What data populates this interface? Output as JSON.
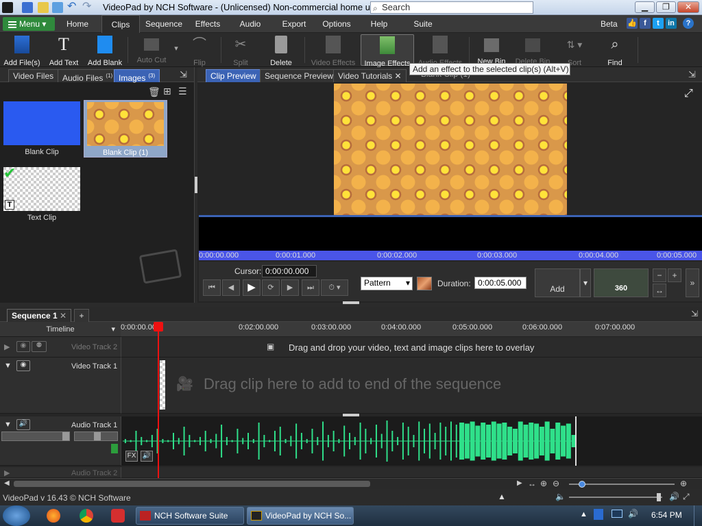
{
  "window": {
    "title": "VideoPad by NCH Software - (Unlicensed) Non-commercial home use only",
    "search_placeholder": "Search"
  },
  "menu": {
    "menu_button": "Menu",
    "items": [
      "Home",
      "Clips",
      "Sequence",
      "Effects",
      "Audio",
      "Export",
      "Options",
      "Help",
      "Suite"
    ],
    "active": "Clips",
    "beta": "Beta"
  },
  "toolbar": {
    "add_files": "Add File(s)",
    "add_text": "Add Text",
    "add_blank": "Add Blank",
    "auto_cut": "Auto Cut",
    "flip": "Flip",
    "split": "Split",
    "delete": "Delete",
    "video_effects": "Video Effects",
    "image_effects": "Image Effects",
    "audio_effects": "Audio Effects",
    "new_bin": "New Bin",
    "delete_bin": "Delete Bin",
    "sort": "Sort",
    "find": "Find"
  },
  "tooltip": "Add an effect to the selected clip(s) (Alt+V)",
  "bin": {
    "tabs": [
      "Video Files",
      "Audio Files",
      "Images"
    ],
    "tab_badges": [
      "",
      "(1)",
      "(3)"
    ],
    "clips": [
      "Blank Clip",
      "Blank Clip (1)",
      "Text Clip"
    ]
  },
  "preview": {
    "tabs": [
      "Clip Preview",
      "Sequence Preview",
      "Video Tutorials"
    ],
    "clip_tab_title": "Blank Clip (1)",
    "ruler": [
      "0:00:00.000",
      "0:00:01.000",
      "0:00:02.000",
      "0:00:03.000",
      "0:00:04.000",
      "0:00:05.000"
    ],
    "cursor_label": "Cursor:",
    "cursor_value": "0:00:00.000",
    "pattern_value": "Pattern",
    "duration_label": "Duration:",
    "duration_value": "0:00:05.000",
    "add_label": "Add",
    "vr_label": "360"
  },
  "sequence": {
    "tab": "Sequence 1",
    "timeline_label": "Timeline",
    "ruler": [
      "0:00:00.000",
      "0:02:00.000",
      "0:03:00.000",
      "0:04:00.000",
      "0:05:00.000",
      "0:06:00.000",
      "0:07:00.000"
    ],
    "video_track_2": "Video Track 2",
    "overlay_hint": "Drag and drop your video, text and image clips here to overlay",
    "video_track_1": "Video Track 1",
    "drag_hint": "Drag clip here to add to end of the sequence",
    "audio_track_1": "Audio Track 1",
    "audio_track_2": "Audio Track 2",
    "fx": "FX"
  },
  "status": {
    "version": "VideoPad v 16.43 © NCH Software"
  },
  "taskbar": {
    "apps": [
      "NCH Software Suite",
      "VideoPad by NCH So..."
    ],
    "clock": "6:54 PM"
  },
  "colors": {
    "accent": "#3b63b5",
    "menu_green": "#2f8a3c",
    "waveform": "#2fe08a",
    "playhead": "#e11111"
  },
  "waveform_levels": [
    0.1,
    0.05,
    0.5,
    0.2,
    0.05,
    0.3,
    0.6,
    0.1,
    0.05,
    0.4,
    0.15,
    0.7,
    0.3,
    0.05,
    0.2,
    0.5,
    0.1,
    0.35,
    0.8,
    0.2,
    0.05,
    0.6,
    0.15,
    0.4,
    0.1,
    0.9,
    0.3,
    0.05,
    0.5,
    0.7,
    0.1,
    0.25,
    0.85,
    0.4,
    0.1,
    0.6,
    0.2,
    0.95,
    0.3,
    0.5,
    0.1,
    0.75,
    0.4,
    0.2,
    0.9,
    0.6,
    0.15,
    0.8,
    0.35,
    1.0,
    0.5,
    0.2,
    0.9,
    0.7,
    0.3,
    0.95,
    0.6,
    0.85,
    0.4,
    0.9,
    0.7,
    0.95,
    0.8,
    0.9,
    0.85,
    0.95,
    0.75,
    0.9,
    0.8,
    0.95,
    0.85,
    0.9,
    0.7,
    0.6,
    0.95,
    0.8,
    0.9,
    0.85,
    0.7,
    0.95,
    0.6,
    0.9,
    0.75,
    0.85,
    0.3
  ]
}
